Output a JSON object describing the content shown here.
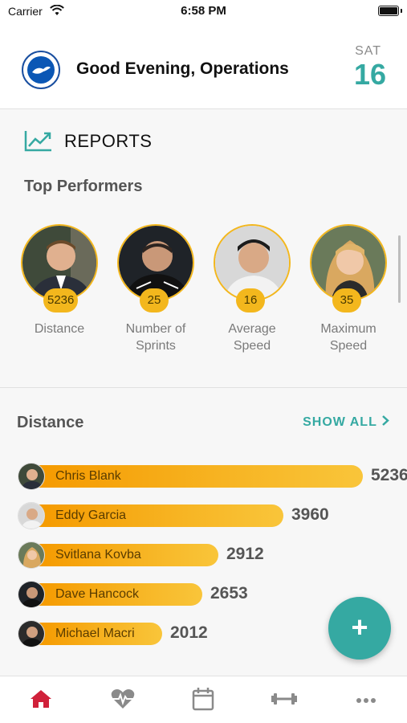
{
  "status_bar": {
    "carrier": "Carrier",
    "time": "6:58 PM"
  },
  "header": {
    "greeting": "Good Evening, Operations",
    "day_name": "SAT",
    "day_number": "16"
  },
  "reports": {
    "title": "REPORTS",
    "top_performers_title": "Top Performers",
    "performers": [
      {
        "value": "5236",
        "label_line1": "Distance",
        "label_line2": ""
      },
      {
        "value": "25",
        "label_line1": "Number of",
        "label_line2": "Sprints"
      },
      {
        "value": "16",
        "label_line1": "Average",
        "label_line2": "Speed"
      },
      {
        "value": "35",
        "label_line1": "Maximum",
        "label_line2": "Speed"
      }
    ]
  },
  "distance": {
    "title": "Distance",
    "show_all": "SHOW ALL",
    "max": 5236,
    "rows": [
      {
        "name": "Chris Blank",
        "value": 5236
      },
      {
        "name": "Eddy Garcia",
        "value": 3960
      },
      {
        "name": "Svitlana Kovba",
        "value": 2912
      },
      {
        "name": "Dave Hancock",
        "value": 2653
      },
      {
        "name": "Michael Macri",
        "value": 2012
      }
    ]
  },
  "fab": {
    "label": "+"
  },
  "colors": {
    "accent": "#35a9a2",
    "gold": "#f3b71d",
    "bar_start": "#f59a00",
    "bar_end": "#f9c53a",
    "tab_active": "#d0213a",
    "tab_inactive": "#8a8a8a"
  },
  "tabs": [
    {
      "icon": "home-icon",
      "active": true
    },
    {
      "icon": "heart-pulse-icon",
      "active": false
    },
    {
      "icon": "calendar-icon",
      "active": false
    },
    {
      "icon": "dumbbell-icon",
      "active": false
    },
    {
      "icon": "more-icon",
      "active": false
    }
  ]
}
